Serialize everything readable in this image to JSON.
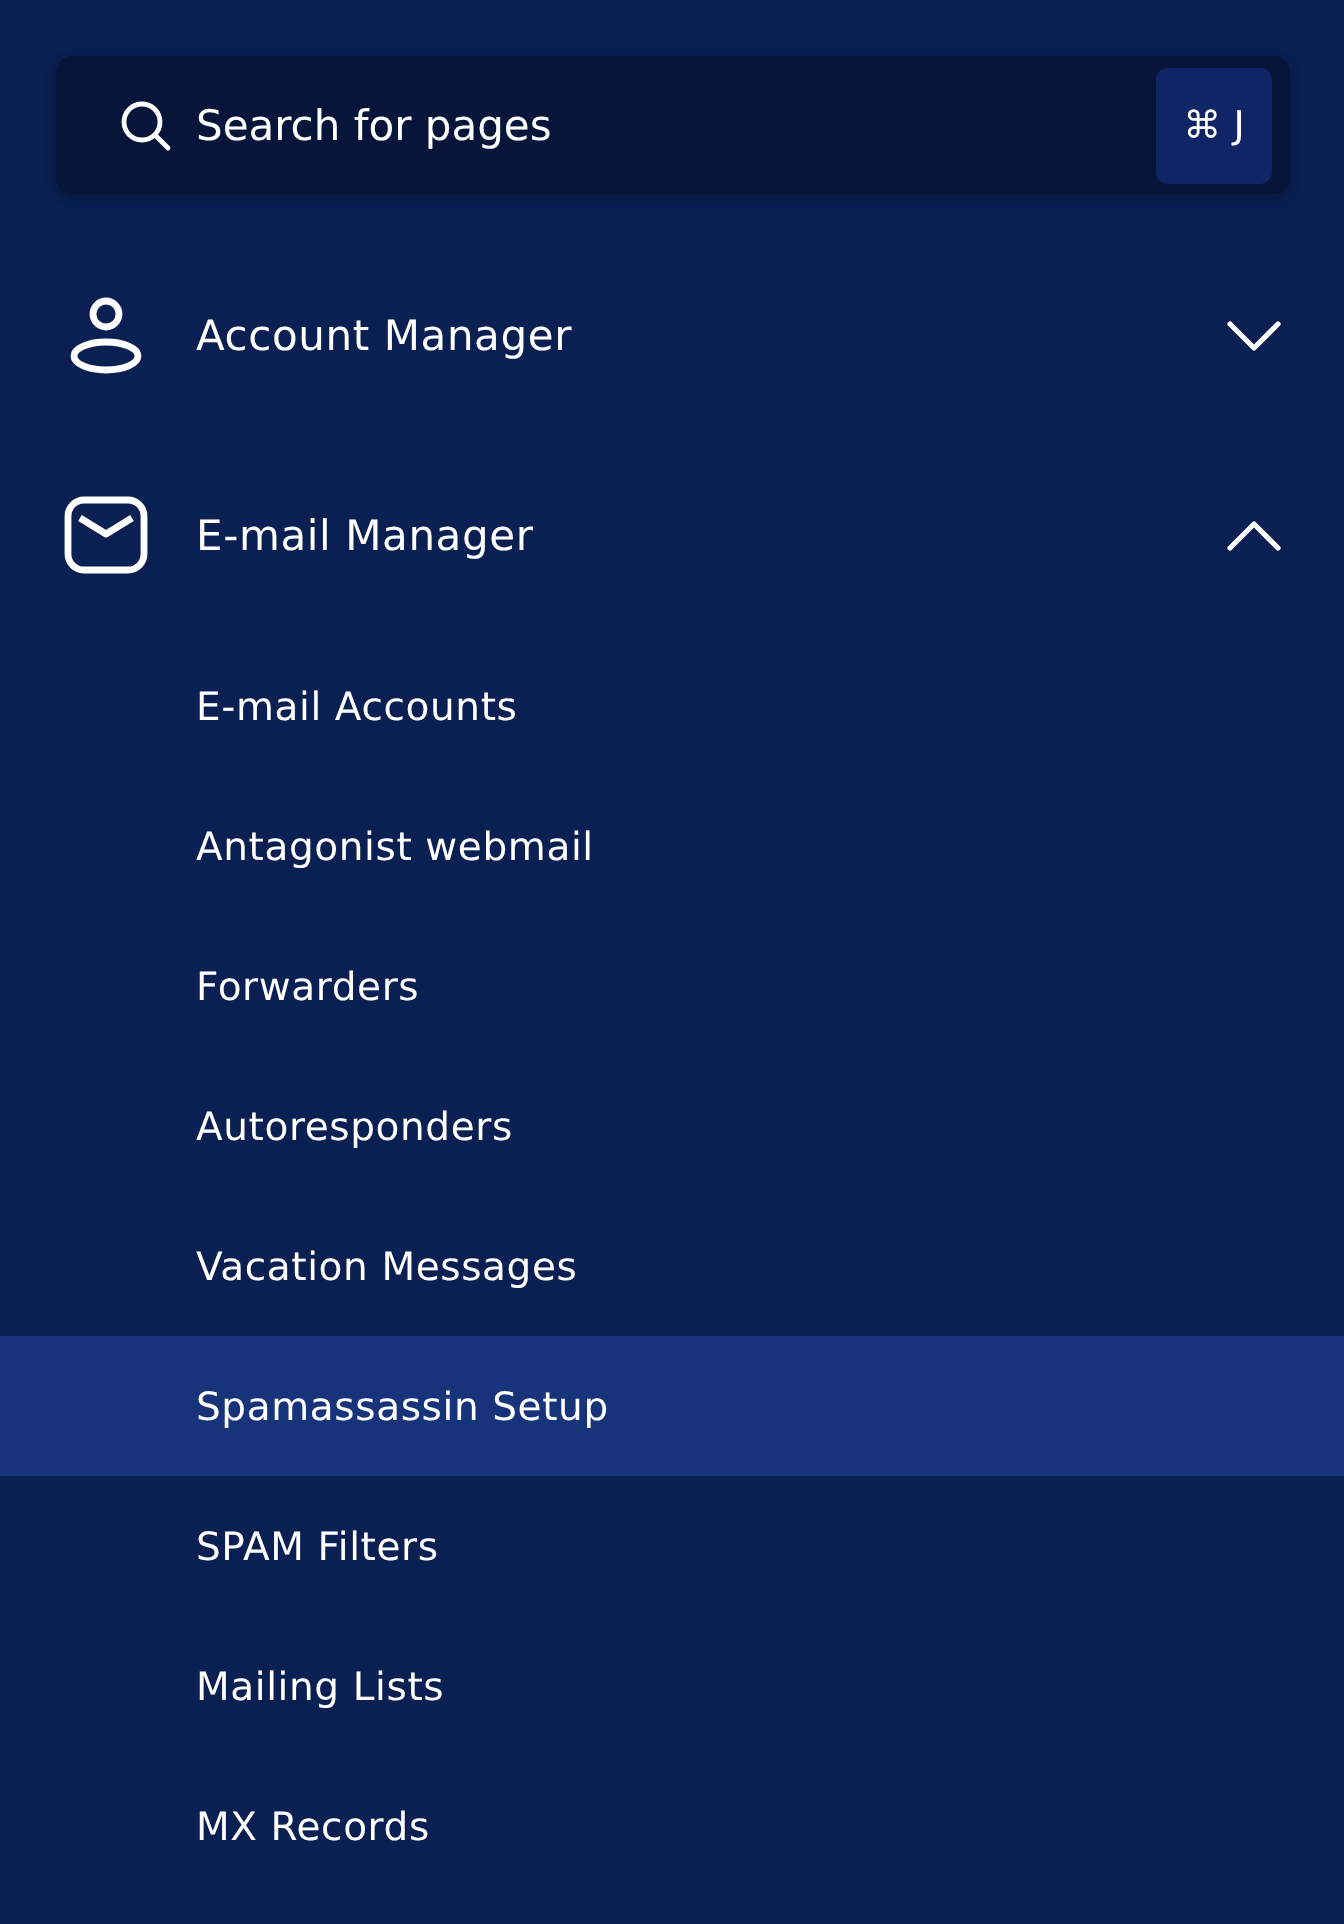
{
  "search": {
    "placeholder": "Search for pages",
    "shortcut": "⌘ J"
  },
  "sections": [
    {
      "label": "Account Manager",
      "kind": "person",
      "expanded": false
    },
    {
      "label": "E-mail Manager",
      "kind": "mail",
      "expanded": true,
      "items": [
        {
          "label": "E-mail Accounts",
          "selected": false
        },
        {
          "label": "Antagonist webmail",
          "selected": false
        },
        {
          "label": "Forwarders",
          "selected": false
        },
        {
          "label": "Autoresponders",
          "selected": false
        },
        {
          "label": "Vacation Messages",
          "selected": false
        },
        {
          "label": "Spamassassin Setup",
          "selected": true
        },
        {
          "label": "SPAM Filters",
          "selected": false
        },
        {
          "label": "Mailing Lists",
          "selected": false
        },
        {
          "label": "MX Records",
          "selected": false
        }
      ]
    }
  ]
}
